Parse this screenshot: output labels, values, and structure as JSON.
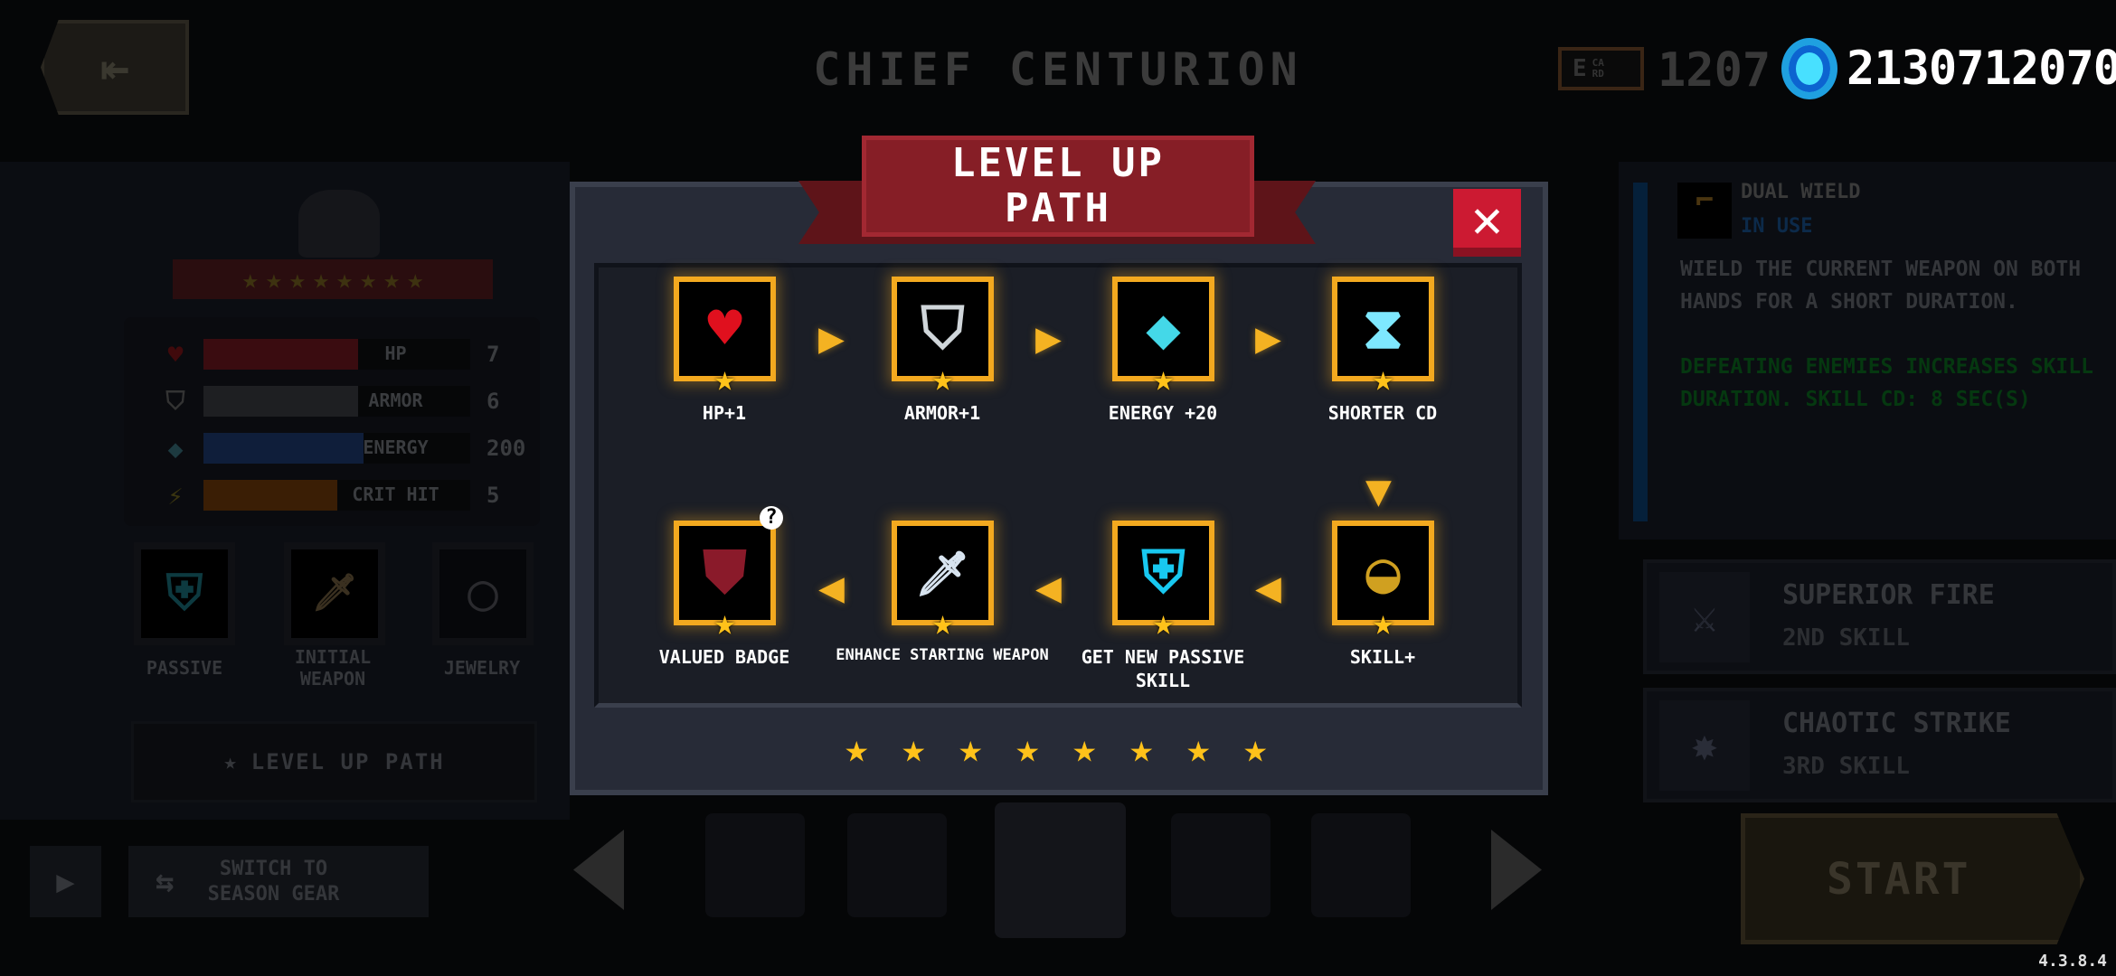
{
  "header": {
    "title": "Chief Centurion",
    "card_icon": "E card",
    "card_count": "1207",
    "gem_icon": "gem-coin",
    "gem_count": "2130712070"
  },
  "left_panel": {
    "stars": 8,
    "stats": [
      {
        "label": "HP",
        "value": "7",
        "fill": 0.58,
        "color": "#3a0c10"
      },
      {
        "label": "Armor",
        "value": "6",
        "fill": 0.58,
        "color": "#1e1f22"
      },
      {
        "label": "Energy",
        "value": "200",
        "fill": 0.6,
        "color": "#0f1e3a"
      },
      {
        "label": "Crit Hit",
        "value": "5",
        "fill": 0.5,
        "color": "#3a1e05"
      }
    ],
    "slots": [
      {
        "label": "Passive"
      },
      {
        "label": "Initial Weapon"
      },
      {
        "label": "Jewelry"
      }
    ],
    "level_up_button": "Level Up Path",
    "switch_button": "Switch to Season Gear"
  },
  "right_panel": {
    "skill_name": "Dual Wield",
    "skill_status": "In use",
    "description": "Wield the current weapon on both hands for a short duration.",
    "bonus": "Defeating enemies increases skill duration. Skill CD: 8 sec(s)",
    "skills": [
      {
        "name": "Superior Fire",
        "tier": "2nd skill"
      },
      {
        "name": "Chaotic Strike",
        "tier": "3rd skill"
      }
    ]
  },
  "modal": {
    "title_line1": "Level Up",
    "title_line2": "Path",
    "close_label": "✕",
    "steps": [
      {
        "label": "HP+1",
        "icon": "heart"
      },
      {
        "label": "Armor+1",
        "icon": "shield"
      },
      {
        "label": "Energy +20",
        "icon": "crystal"
      },
      {
        "label": "Shorter CD",
        "icon": "hourglass"
      },
      {
        "label": "Skill+",
        "icon": "skill-orb"
      },
      {
        "label": "Get new passive skill",
        "icon": "passive-shield"
      },
      {
        "label": "Enhance starting weapon",
        "icon": "sword"
      },
      {
        "label": "Valued Badge",
        "icon": "badge"
      }
    ],
    "stars_earned": 8
  },
  "start_button": "Start",
  "version": "4.3.8.4"
}
